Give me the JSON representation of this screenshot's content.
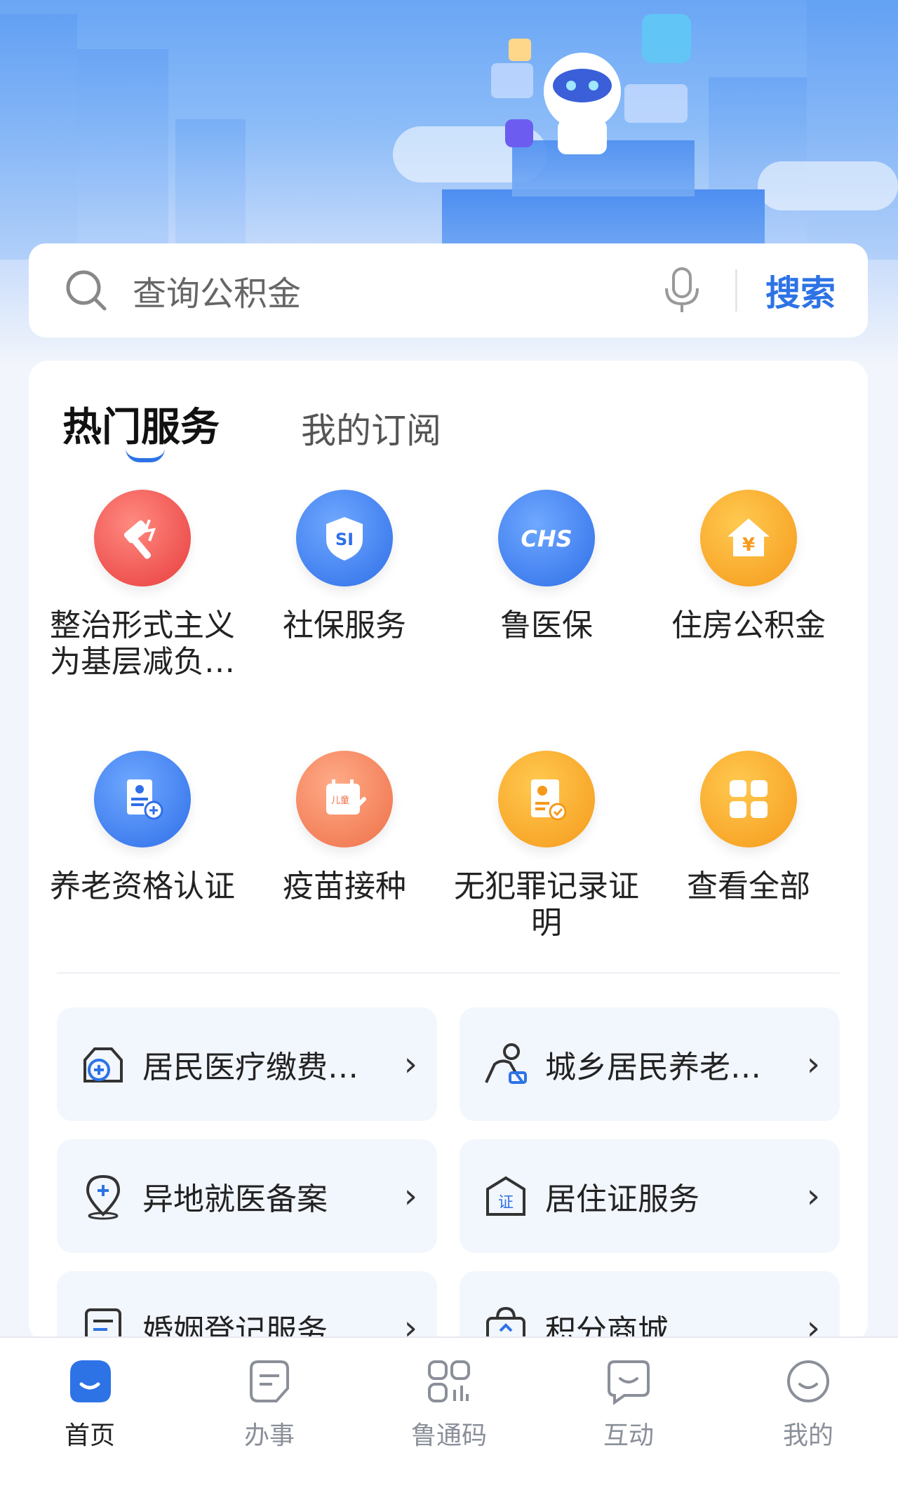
{
  "search": {
    "placeholder": "查询公积金",
    "button_label": "搜索"
  },
  "tabs": {
    "hot": "热门服务",
    "subscribed": "我的订阅"
  },
  "services": [
    {
      "label": "整治形式主义为基层减负…",
      "icon": "gavel-icon"
    },
    {
      "label": "社保服务",
      "icon": "social-security-shield-icon"
    },
    {
      "label": "鲁医保",
      "icon": "chs-badge-icon"
    },
    {
      "label": "住房公积金",
      "icon": "house-yuan-icon"
    },
    {
      "label": "养老资格认证",
      "icon": "document-add-icon"
    },
    {
      "label": "疫苗接种",
      "icon": "vaccine-calendar-icon"
    },
    {
      "label": "无犯罪记录证明",
      "icon": "police-certificate-icon"
    },
    {
      "label": "查看全部",
      "icon": "grid-icon"
    }
  ],
  "tiles": [
    {
      "label": "居民医疗缴费…",
      "icon": "medical-bag-icon"
    },
    {
      "label": "城乡居民养老…",
      "icon": "elderly-person-icon"
    },
    {
      "label": "异地就医备案",
      "icon": "location-plus-icon"
    },
    {
      "label": "居住证服务",
      "icon": "residence-permit-icon"
    },
    {
      "label": "婚姻登记服务",
      "icon": "document-list-icon"
    },
    {
      "label": "积分商城",
      "icon": "shopping-bag-icon"
    }
  ],
  "bottom_nav": [
    {
      "label": "首页",
      "icon": "home-face-icon",
      "active": true
    },
    {
      "label": "办事",
      "icon": "service-doc-icon",
      "active": false
    },
    {
      "label": "鲁通码",
      "icon": "qr-code-icon",
      "active": false
    },
    {
      "label": "互动",
      "icon": "chat-icon",
      "active": false
    },
    {
      "label": "我的",
      "icon": "profile-smile-icon",
      "active": false
    }
  ],
  "colors": {
    "accent": "#2d73e6",
    "background": "#f2f5fb"
  }
}
